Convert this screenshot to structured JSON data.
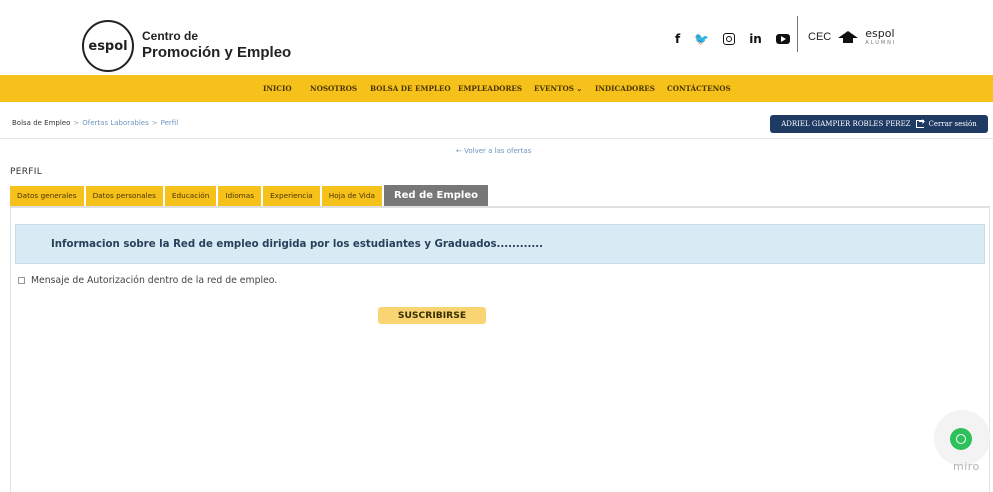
{
  "header": {
    "logo_mark": "espol",
    "logo_line1": "Centro de",
    "logo_line2": "Promoción y Empleo",
    "social": {
      "facebook": "f",
      "twitter": "🐦",
      "linkedin": "in"
    },
    "partner": {
      "cec": "CEC",
      "espol": "espol",
      "espol_sub": "ALUMNI"
    }
  },
  "nav": {
    "items": [
      "INICIO",
      "NOSOTROS",
      "BOLSA DE EMPLEO",
      "EMPLEADORES",
      "EVENTOS ⌄",
      "INDICADORES",
      "CONTÁCTENOS"
    ]
  },
  "breadcrumb": {
    "items": [
      "Bolsa de Empleo",
      "Ofertas Laborables",
      "Perfil"
    ],
    "separator": ">"
  },
  "user": {
    "name": "ADRIEL GIAMPIER ROBLES PEREZ",
    "logout": "Cerrar sesión"
  },
  "back_link": "← Volver a las ofertas",
  "page_title": "PERFIL",
  "tabs": [
    "Datos generales",
    "Datos personales",
    "Educación",
    "Idiomas",
    "Experiencia",
    "Hoja de Vida",
    "Red de Empleo"
  ],
  "active_tab": "Red de Empleo",
  "info": {
    "text": "Informacion sobre la Red de empleo dirigida por los estudiantes y Graduados............"
  },
  "authorization": {
    "label": "Mensaje de Autorización dentro de la red de empleo.",
    "checked": false
  },
  "subscribe_button": "SUSCRIBIRSE",
  "miro": "miro",
  "colors": {
    "nav_bg": "#f6c11a",
    "user_btn": "#1f3a63",
    "info_bg": "#d8eaf4",
    "subscribe_bg": "#f9d472",
    "whatsapp": "#2ec05a"
  }
}
